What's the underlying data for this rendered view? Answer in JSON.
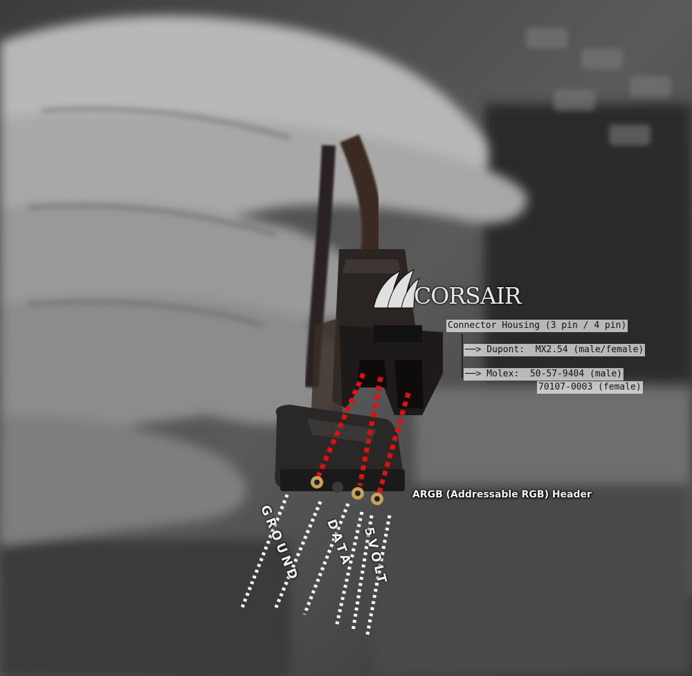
{
  "brand": {
    "logo_text": "CORSAIR"
  },
  "housing_annotation": {
    "title": "Connector Housing (3 pin / 4 pin)",
    "dupont_line": "──> Dupont:  MX2.54 (male/female)",
    "molex_line": "──> Molex:  50-57-9404 (male)",
    "molex_line_2": "70107-0003 (female)"
  },
  "header_label": "ARGB (Addressable RGB) Header",
  "pins": {
    "ground": "GROUND",
    "data": "DATA",
    "five_volt": "5VOLT"
  },
  "colors": {
    "pin_line_red": "#e01010",
    "pin_line_white": "#ffffff"
  }
}
